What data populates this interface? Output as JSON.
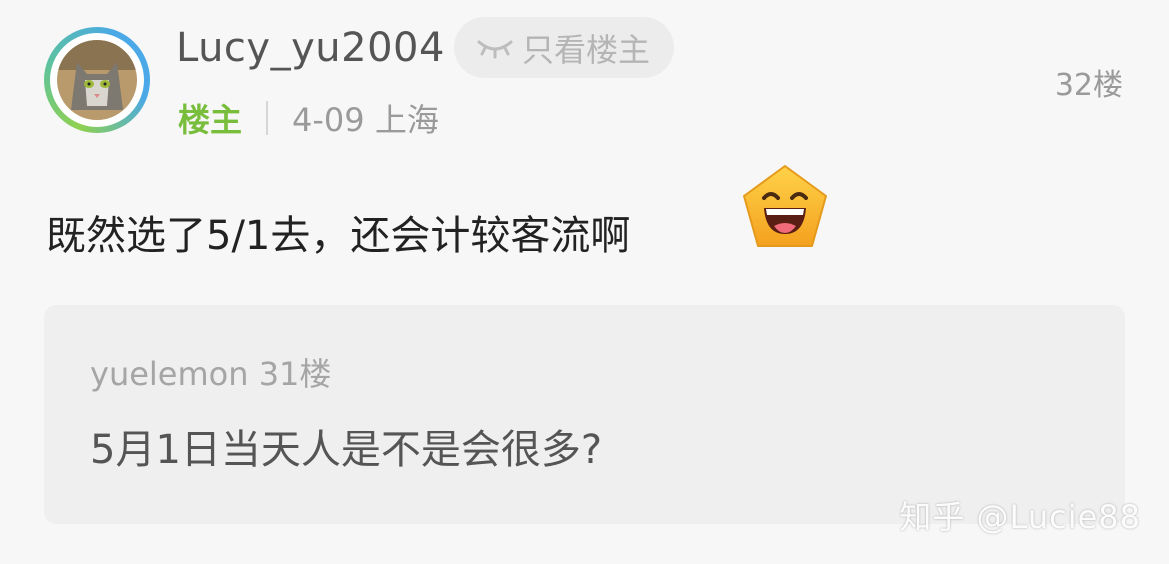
{
  "post": {
    "username": "Lucy_yu2004",
    "only_op_label": "只看楼主",
    "floor_label": "32楼",
    "op_badge": "楼主",
    "date_location": "4-09 上海",
    "content": "既然选了5/1去，还会计较客流啊"
  },
  "quote": {
    "author": "yuelemon",
    "floor": "31楼",
    "text": "5月1日当天人是不是会很多?"
  },
  "watermark": "知乎 @Lucie88",
  "icons": {
    "only_op": "eye-closed-icon",
    "emoji": "grinning-face-emoji"
  },
  "colors": {
    "op_badge": "#78be3c",
    "avatar_ring_start": "#8fd14f",
    "avatar_ring_end": "#4aa9e6",
    "emoji_face": "#f9b92a"
  }
}
